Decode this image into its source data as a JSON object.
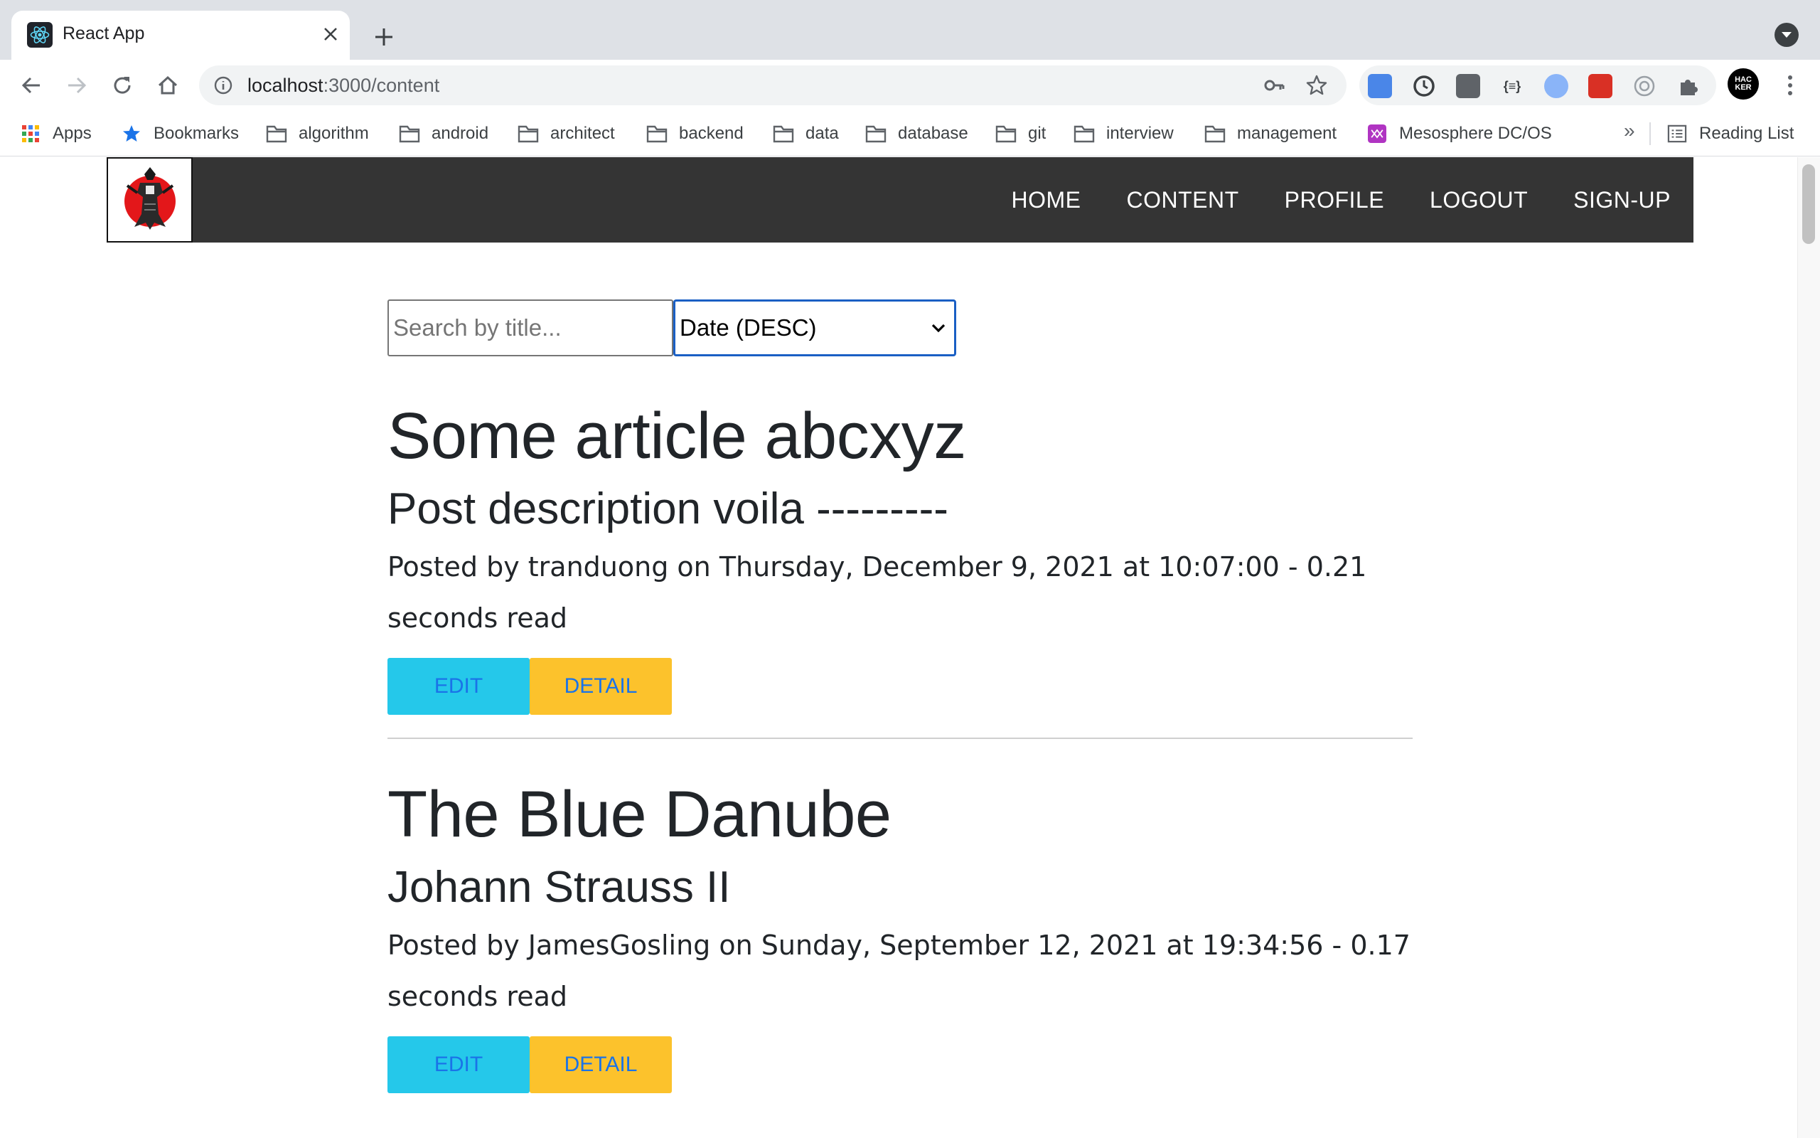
{
  "browser": {
    "tab_title": "React App",
    "url_host": "localhost",
    "url_path": ":3000/content",
    "bookmarks": [
      {
        "label": "Apps",
        "icon": "apps-grid-icon"
      },
      {
        "label": "Bookmarks",
        "icon": "star-icon"
      },
      {
        "label": "algorithm",
        "icon": "folder-icon"
      },
      {
        "label": "android",
        "icon": "folder-icon"
      },
      {
        "label": "architect",
        "icon": "folder-icon"
      },
      {
        "label": "backend",
        "icon": "folder-icon"
      },
      {
        "label": "data",
        "icon": "folder-icon"
      },
      {
        "label": "database",
        "icon": "folder-icon"
      },
      {
        "label": "git",
        "icon": "folder-icon"
      },
      {
        "label": "interview",
        "icon": "folder-icon"
      },
      {
        "label": "management",
        "icon": "folder-icon"
      },
      {
        "label": "Mesosphere DC/OS",
        "icon": "mesosphere-icon"
      }
    ],
    "more_bookmarks": "»",
    "reading_list": "Reading List",
    "profile_text": "HAC KER"
  },
  "app": {
    "nav": [
      "HOME",
      "CONTENT",
      "PROFILE",
      "LOGOUT",
      "SIGN-UP"
    ],
    "search_placeholder": "Search by title...",
    "sort_value": "Date (DESC)"
  },
  "articles": [
    {
      "title": "Some article abcxyz",
      "description": "Post description voila ---------",
      "meta": "Posted by tranduong on Thursday, December 9, 2021 at 10:07:00 - 0.21 seconds read",
      "edit_label": "EDIT",
      "detail_label": "DETAIL"
    },
    {
      "title": "The Blue Danube",
      "description": "Johann Strauss II",
      "meta": "Posted by JamesGosling on Sunday, September 12, 2021 at 19:34:56 - 0.17 seconds read",
      "edit_label": "EDIT",
      "detail_label": "DETAIL"
    }
  ],
  "colors": {
    "navbar": "#343434",
    "edit_button": "#25c8ea",
    "detail_button": "#fcc22c",
    "button_text": "#1a73e8",
    "select_focus": "#1a5fc4"
  }
}
